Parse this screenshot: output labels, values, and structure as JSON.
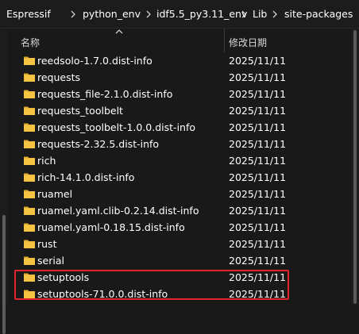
{
  "breadcrumb": [
    {
      "label": "Espressif"
    },
    {
      "label": "python_env"
    },
    {
      "label": "idf5.5_py3.11_env"
    },
    {
      "label": "Lib"
    },
    {
      "label": "site-packages"
    }
  ],
  "columns": {
    "name": "名称",
    "date_modified": "修改日期"
  },
  "files": [
    {
      "name": "reedsolo-1.7.0.dist-info",
      "date": "2025/11/11"
    },
    {
      "name": "requests",
      "date": "2025/11/11"
    },
    {
      "name": "requests_file-2.1.0.dist-info",
      "date": "2025/11/11"
    },
    {
      "name": "requests_toolbelt",
      "date": "2025/11/11"
    },
    {
      "name": "requests_toolbelt-1.0.0.dist-info",
      "date": "2025/11/11"
    },
    {
      "name": "requests-2.32.5.dist-info",
      "date": "2025/11/11"
    },
    {
      "name": "rich",
      "date": "2025/11/11"
    },
    {
      "name": "rich-14.1.0.dist-info",
      "date": "2025/11/11"
    },
    {
      "name": "ruamel",
      "date": "2025/11/11"
    },
    {
      "name": "ruamel.yaml.clib-0.2.14.dist-info",
      "date": "2025/11/11"
    },
    {
      "name": "ruamel.yaml-0.18.15.dist-info",
      "date": "2025/11/11"
    },
    {
      "name": "rust",
      "date": "2025/11/11"
    },
    {
      "name": "serial",
      "date": "2025/11/11"
    },
    {
      "name": "setuptools",
      "date": "2025/11/11"
    },
    {
      "name": "setuptools-71.0.0.dist-info",
      "date": "2025/11/11"
    }
  ],
  "colors": {
    "background": "#191919",
    "folder": "#f6c443",
    "highlight_border": "#e0242b"
  },
  "icons": {
    "folder": "folder-icon",
    "chevron": "chevron-right-icon",
    "sort": "sort-up-icon"
  }
}
